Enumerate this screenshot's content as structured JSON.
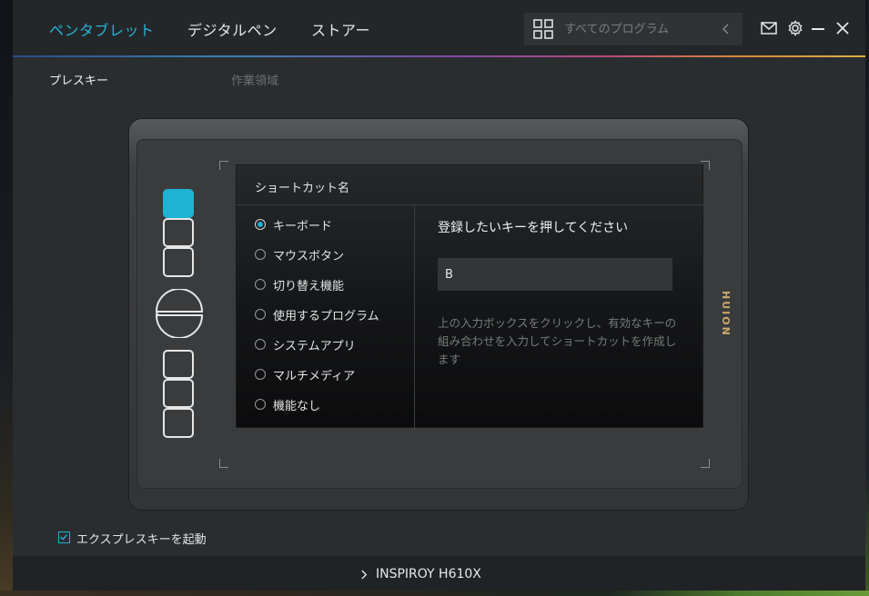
{
  "nav": {
    "tabs": [
      {
        "label": "ペンタブレット",
        "active": true
      },
      {
        "label": "デジタルペン",
        "active": false
      },
      {
        "label": "ストアー",
        "active": false
      }
    ],
    "search_placeholder": "すべてのプログラム",
    "icons": [
      "grid-icon",
      "chevron-left-icon",
      "mail-icon",
      "gear-icon",
      "minimize-icon",
      "close-icon"
    ]
  },
  "subtabs": [
    {
      "label": "プレスキー",
      "active": true
    },
    {
      "label": "作業領域",
      "active": false
    }
  ],
  "tablet": {
    "brand": "HUION",
    "selected_key": 1,
    "key_count": 6
  },
  "shortcut_panel": {
    "title": "ショートカット名",
    "options": [
      {
        "label": "キーボード",
        "selected": true
      },
      {
        "label": "マウスボタン",
        "selected": false
      },
      {
        "label": "切り替え機能",
        "selected": false
      },
      {
        "label": "使用するプログラム",
        "selected": false
      },
      {
        "label": "システムアプリ",
        "selected": false
      },
      {
        "label": "マルチメディア",
        "selected": false
      },
      {
        "label": "機能なし",
        "selected": false
      }
    ],
    "right_title": "登録したいキーを押してください",
    "key_value": "B",
    "help_text": "上の入力ボックスをクリックし、有効なキーの組み合わせを入力してショートカットを作成します"
  },
  "express_toggle": {
    "label": "エクスプレスキーを起動",
    "checked": true
  },
  "footer": {
    "device_name": "INSPIROY H610X"
  },
  "colors": {
    "accent": "#1fb3d3",
    "brand_gold": "#c9a86a"
  }
}
